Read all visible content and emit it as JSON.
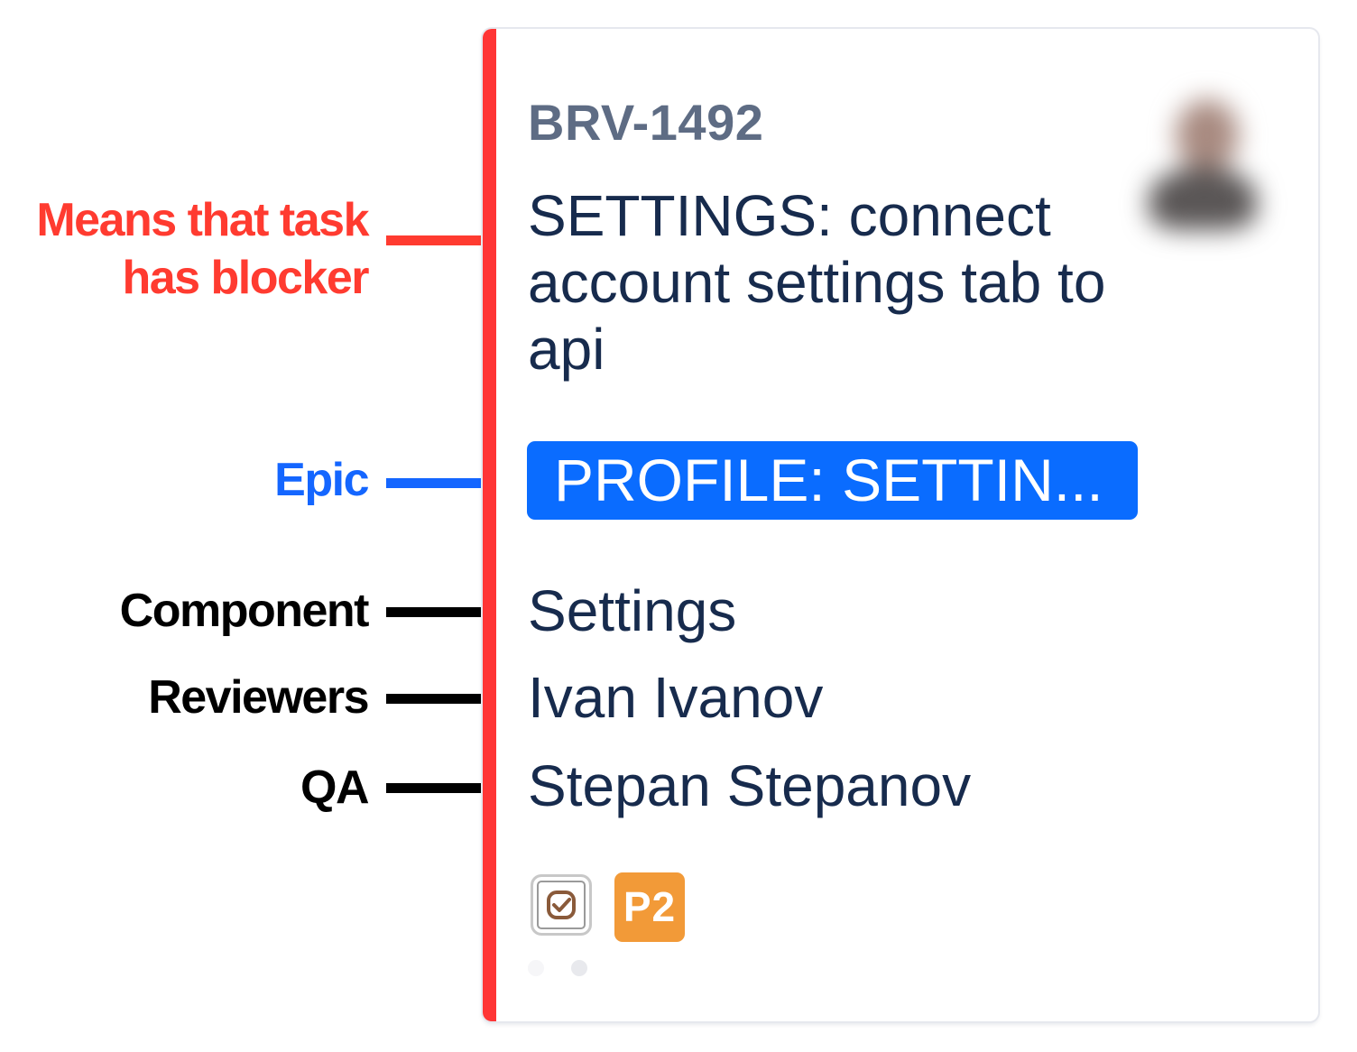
{
  "annotations": {
    "blocker": {
      "label_line1": "Means that task",
      "label_line2": "has blocker",
      "color": "#ff3b30"
    },
    "epic": {
      "label": "Epic",
      "color": "#1466ff"
    },
    "component": {
      "label": "Component",
      "color": "#000000"
    },
    "reviewers": {
      "label": "Reviewers",
      "color": "#000000"
    },
    "qa": {
      "label": "QA",
      "color": "#000000"
    }
  },
  "card": {
    "blocker_bar_color": "#ff3535",
    "issue_key": "BRV-1492",
    "summary": "SETTINGS: connect account settings tab to api",
    "avatar_icon": "user-avatar-icon",
    "epic": {
      "label": "PROFILE: SETTIN...",
      "color": "#0a6cff"
    },
    "component": "Settings",
    "reviewers": "Ivan Ivanov",
    "qa": "Stepan Stepanov",
    "issue_type_icon": "story-checkbox-icon",
    "priority": {
      "label": "P2",
      "color": "#f29a38"
    }
  }
}
